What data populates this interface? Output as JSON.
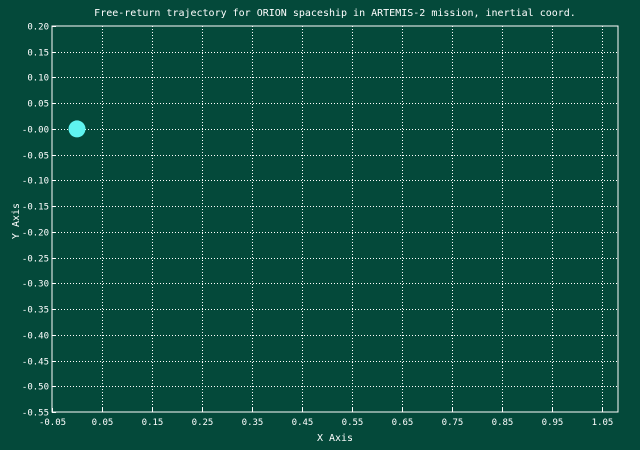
{
  "colors": {
    "background": "#04493a",
    "foreground": "#ffffff",
    "grid": "#ffffff",
    "series": "#5ff4f0"
  },
  "chart_data": {
    "type": "scatter",
    "title": "Free-return trajectory for ORION spaceship in ARTEMIS-2 mission, inertial coord.",
    "xlabel": "X Axis",
    "ylabel": "Y Axis",
    "xlim": [
      -0.05,
      1.1
    ],
    "ylim": [
      -0.55,
      0.2
    ],
    "grid": true,
    "grid_style": "dotted",
    "x_ticks": [
      -0.05,
      0.05,
      0.15,
      0.25,
      0.35,
      0.45,
      0.55,
      0.65,
      0.75,
      0.85,
      0.95,
      1.05
    ],
    "x_tick_labels": [
      "-0.05",
      "0.05",
      "0.15",
      "0.25",
      "0.35",
      "0.45",
      "0.55",
      "0.65",
      "0.75",
      "0.85",
      "0.95",
      "1.05"
    ],
    "y_ticks": [
      0.2,
      0.15,
      0.1,
      0.05,
      0.0,
      -0.05,
      -0.1,
      -0.15,
      -0.2,
      -0.25,
      -0.3,
      -0.35,
      -0.4,
      -0.45,
      -0.5,
      -0.55
    ],
    "y_tick_labels": [
      "0.20",
      "0.15",
      "0.10",
      "0.05",
      "-0.00",
      "-0.05",
      "-0.10",
      "-0.15",
      "-0.20",
      "-0.25",
      "-0.30",
      "-0.35",
      "-0.40",
      "-0.45",
      "-0.50",
      "-0.55"
    ],
    "series": [
      {
        "points": [
          [
            0.0,
            0.0
          ]
        ],
        "color": "#5ff4f0",
        "marker": "filled-circle"
      }
    ]
  }
}
